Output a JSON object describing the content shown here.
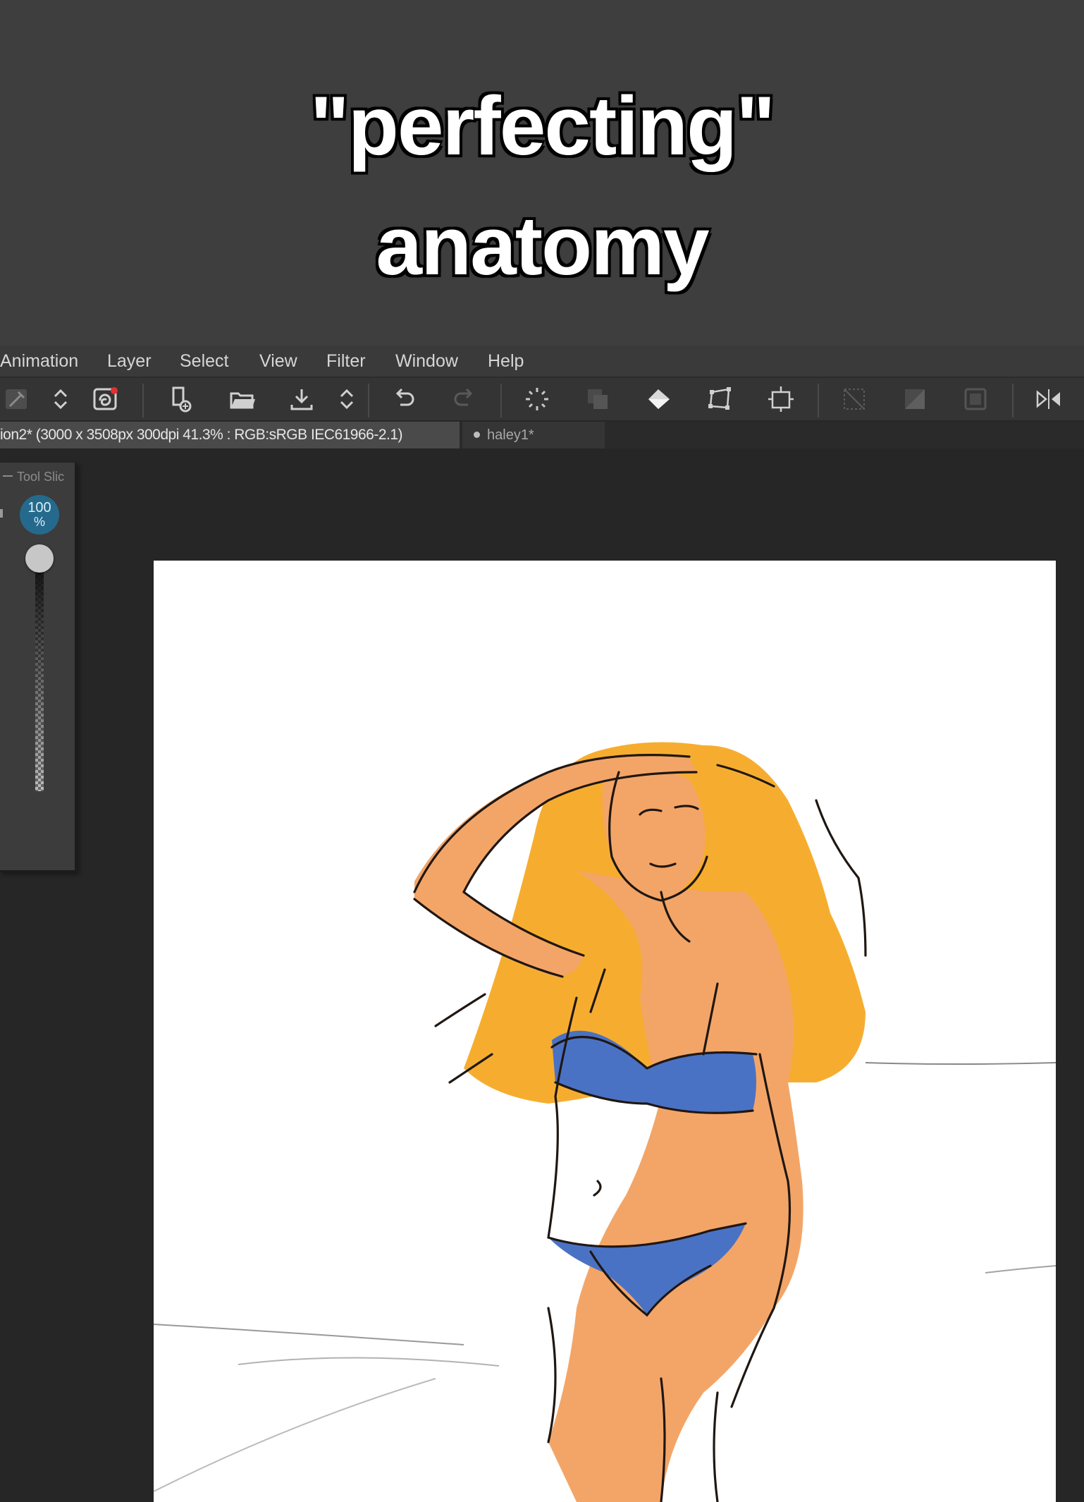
{
  "caption": {
    "line1": "\"perfecting\"",
    "line2": "anatomy"
  },
  "menu": [
    {
      "label": "Animation"
    },
    {
      "label": "Layer"
    },
    {
      "label": "Select"
    },
    {
      "label": "View"
    },
    {
      "label": "Filter"
    },
    {
      "label": "Window"
    },
    {
      "label": "Help"
    }
  ],
  "toolbar": {
    "icons": [
      "eyedropper-icon",
      "stepper-icon",
      "swirl-icon",
      "new-document-icon",
      "open-folder-icon",
      "save-icon",
      "stepper-icon",
      "undo-icon",
      "redo-icon",
      "loading-icon",
      "copy-layer-icon",
      "fill-icon",
      "transform-icon",
      "crop-icon",
      "deselect-icon",
      "invert-selection-icon",
      "frame-icon",
      "mirror-icon"
    ]
  },
  "tabs": {
    "active": "ion2* (3000 x 3508px 300dpi 41.3% : RGB:sRGB IEC61966-2.1)",
    "inactive": "haley1*"
  },
  "tool_slider": {
    "title": "Tool Slic",
    "percent_value": "100",
    "percent_unit": "%",
    "level": 1.0
  },
  "colors": {
    "hair": "#f6ad2f",
    "skin": "#f3a567",
    "bikini": "#4a72c4",
    "lineart": "#1f1712",
    "accent": "#256a8c"
  }
}
